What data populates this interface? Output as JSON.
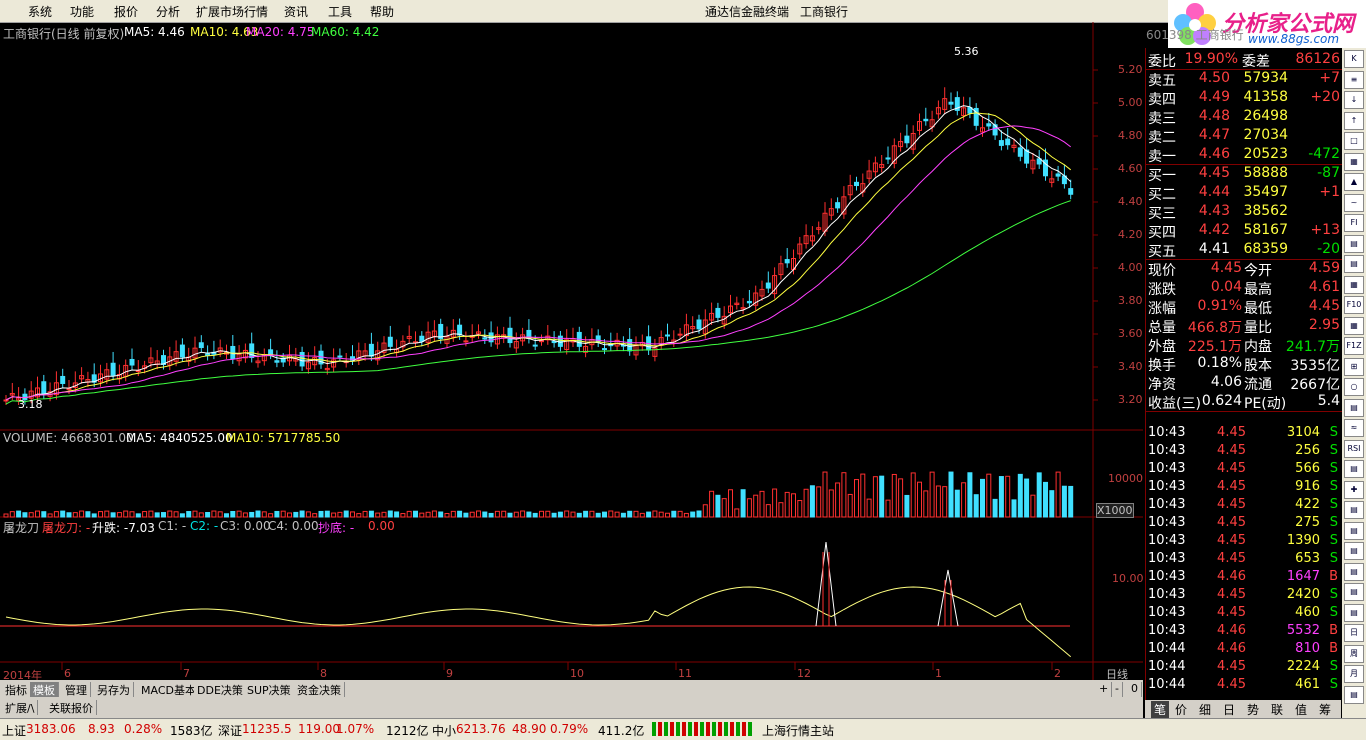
{
  "menu": [
    "系统",
    "功能",
    "报价",
    "分析",
    "扩展市场行情",
    "资讯",
    "工具",
    "帮助"
  ],
  "window_title": "通达信金融终端",
  "window_stock": "工商银行",
  "stock_code_tab": "行",
  "logo": {
    "brand": "分析家公式网",
    "url": "www.88gs.com"
  },
  "header": {
    "name": "工商银行(日线 前复权)",
    "ma5": "MA5: 4.46",
    "ma10": "MA10: 4.63",
    "ma20": "MA20: 4.75",
    "ma60": "MA60: 4.42"
  },
  "price_axis": [
    "5.20",
    "5.00",
    "4.80",
    "4.60",
    "4.40",
    "4.20",
    "4.00",
    "3.80",
    "3.60",
    "3.40",
    "3.20"
  ],
  "price_marks": {
    "high": "5.36",
    "low": "3.18"
  },
  "volume_header": {
    "vol": "VOLUME: 4668301.00",
    "ma5": "MA5: 4840525.00",
    "ma10": "MA10: 5717785.50"
  },
  "volume_axis": {
    "label": "10000",
    "unit": "X1000"
  },
  "indicator_header": {
    "name": "屠龙刀",
    "t1": "屠龙刀: -",
    "t2": "升跌: -7.03",
    "t3": "C1: -",
    "t4": "C2: -",
    "t5": "C3: 0.00",
    "t6": "C4: 0.00",
    "t7": "抄底: -",
    "t8": "0.00"
  },
  "indicator_axis": "10.00",
  "time_axis": {
    "year": "2014年",
    "months": [
      "6",
      "7",
      "8",
      "9",
      "10",
      "11",
      "12",
      "1",
      "2"
    ],
    "period": "日线"
  },
  "bottom_tabs": [
    "指标",
    "模板",
    "管理",
    "另存为",
    "MACD基本",
    "DDE决策",
    "SUP决策",
    "资金决策"
  ],
  "bottom_tabs2": [
    "扩展/\\",
    "关联报价"
  ],
  "zoom_controls": [
    "+",
    "-",
    "0"
  ],
  "code_header": "601398 工商银行",
  "orderbook": {
    "weibi": {
      "label": "委比",
      "value": "19.90%",
      "label2": "委差",
      "value2": "86126"
    },
    "asks": [
      {
        "label": "卖五",
        "price": "4.50",
        "vol": "57934",
        "chg": "+7"
      },
      {
        "label": "卖四",
        "price": "4.49",
        "vol": "41358",
        "chg": "+20"
      },
      {
        "label": "卖三",
        "price": "4.48",
        "vol": "26498",
        "chg": ""
      },
      {
        "label": "卖二",
        "price": "4.47",
        "vol": "27034",
        "chg": ""
      },
      {
        "label": "卖一",
        "price": "4.46",
        "vol": "20523",
        "chg": "-472"
      }
    ],
    "bids": [
      {
        "label": "买一",
        "price": "4.45",
        "vol": "58888",
        "chg": "-87"
      },
      {
        "label": "买二",
        "price": "4.44",
        "vol": "35497",
        "chg": "+1"
      },
      {
        "label": "买三",
        "price": "4.43",
        "vol": "38562",
        "chg": ""
      },
      {
        "label": "买四",
        "price": "4.42",
        "vol": "58167",
        "chg": "+13"
      },
      {
        "label": "买五",
        "price": "4.41",
        "vol": "68359",
        "chg": "-20"
      }
    ]
  },
  "quote": [
    {
      "l1": "现价",
      "v1": "4.45",
      "l2": "今开",
      "v2": "4.59"
    },
    {
      "l1": "涨跌",
      "v1": "0.04",
      "l2": "最高",
      "v2": "4.61"
    },
    {
      "l1": "涨幅",
      "v1": "0.91%",
      "l2": "最低",
      "v2": "4.45"
    },
    {
      "l1": "总量",
      "v1": "466.8万",
      "l2": "量比",
      "v2": "2.95"
    },
    {
      "l1": "外盘",
      "v1": "225.1万",
      "l2": "内盘",
      "v2": "241.7万"
    },
    {
      "l1": "换手",
      "v1": "0.18%",
      "l2": "股本",
      "v2": "3535亿"
    },
    {
      "l1": "净资",
      "v1": "4.06",
      "l2": "流通",
      "v2": "2667亿"
    },
    {
      "l1": "收益(三)",
      "v1": "0.624",
      "l2": "PE(动)",
      "v2": "5.4"
    }
  ],
  "ticks": [
    {
      "t": "10:43",
      "p": "4.45",
      "v": "3104",
      "s": "S"
    },
    {
      "t": "10:43",
      "p": "4.45",
      "v": "256",
      "s": "S"
    },
    {
      "t": "10:43",
      "p": "4.45",
      "v": "566",
      "s": "S"
    },
    {
      "t": "10:43",
      "p": "4.45",
      "v": "916",
      "s": "S"
    },
    {
      "t": "10:43",
      "p": "4.45",
      "v": "422",
      "s": "S"
    },
    {
      "t": "10:43",
      "p": "4.45",
      "v": "275",
      "s": "S"
    },
    {
      "t": "10:43",
      "p": "4.45",
      "v": "1390",
      "s": "S"
    },
    {
      "t": "10:43",
      "p": "4.45",
      "v": "653",
      "s": "S"
    },
    {
      "t": "10:43",
      "p": "4.46",
      "v": "1647",
      "s": "B"
    },
    {
      "t": "10:43",
      "p": "4.45",
      "v": "2420",
      "s": "S"
    },
    {
      "t": "10:43",
      "p": "4.45",
      "v": "460",
      "s": "S"
    },
    {
      "t": "10:43",
      "p": "4.46",
      "v": "5532",
      "s": "B"
    },
    {
      "t": "10:44",
      "p": "4.46",
      "v": "810",
      "s": "B"
    },
    {
      "t": "10:44",
      "p": "4.45",
      "v": "2224",
      "s": "S"
    },
    {
      "t": "10:44",
      "p": "4.45",
      "v": "461",
      "s": "S"
    }
  ],
  "right_tabs": [
    "笔",
    "价",
    "细",
    "日",
    "势",
    "联",
    "值",
    "筹"
  ],
  "status": {
    "sh_label": "上证",
    "sh_val": "3183.06",
    "sh_chg": "8.93",
    "sh_pct": "0.28%",
    "sh_amt": "1583亿",
    "sz_label": "深证",
    "sz_val": "11235.5",
    "sz_chg": "119.00",
    "sz_pct": "1.07%",
    "sz_amt": "1212亿",
    "zx_label": "中小",
    "zx_val": "6213.76",
    "zx_chg": "48.90",
    "zx_pct": "0.79%",
    "zx_amt": "411.2亿",
    "server": "上海行情主站"
  },
  "icon_bar": [
    "K",
    "≡",
    "↓",
    "↑",
    "□",
    "▦",
    "▲",
    "~",
    "FI",
    "▤",
    "▤",
    "▦",
    "F10",
    "▦",
    "F1Z",
    "⊞",
    "○",
    "▤",
    "≈",
    "RSI",
    "▤",
    "✚",
    "▤",
    "▤",
    "▤",
    "▤",
    "▤",
    "▤",
    "日",
    "周",
    "月",
    "▤"
  ]
}
